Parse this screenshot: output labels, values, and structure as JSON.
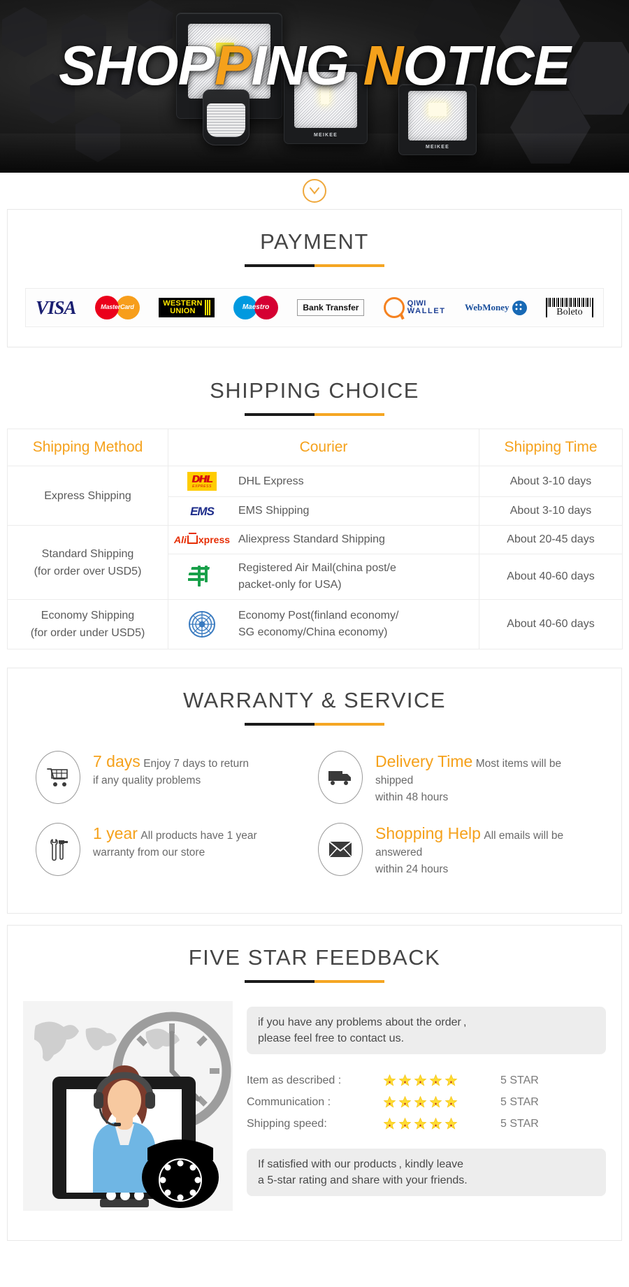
{
  "banner": {
    "title_part1": "SHOP",
    "title_highlight1": "P",
    "title_part2": "ING ",
    "title_highlight2": "N",
    "title_part3": "OTICE",
    "full_title": "SHOPPING NOTICE",
    "brand_tag": "MEIKEE",
    "accent_color": "#F5A11B"
  },
  "scroll_hint": {
    "icon": "chevron-down-icon"
  },
  "payment": {
    "title": "PAYMENT",
    "methods": [
      {
        "name": "VISA",
        "icon": "visa-logo"
      },
      {
        "name": "MasterCard",
        "icon": "mastercard-logo"
      },
      {
        "name": "WESTERN UNION",
        "line1": "WESTERN",
        "line2": "UNION",
        "icon": "western-union-logo"
      },
      {
        "name": "Maestro",
        "icon": "maestro-logo"
      },
      {
        "name": "Bank Transfer",
        "icon": "bank-transfer-logo"
      },
      {
        "name": "QIWI WALLET",
        "line1": "QIWI",
        "line2": "WALLET",
        "icon": "qiwi-wallet-logo"
      },
      {
        "name": "WebMoney",
        "icon": "webmoney-logo"
      },
      {
        "name": "Boleto",
        "icon": "boleto-logo"
      }
    ]
  },
  "shipping": {
    "title": "SHIPPING CHOICE",
    "headers": [
      "Shipping Method",
      "Courier",
      "Shipping Time"
    ],
    "rows": [
      {
        "method": "Express Shipping",
        "method_rowspan": 2,
        "logo": "dhl-logo",
        "courier": "DHL Express",
        "time": "About 3-10 days"
      },
      {
        "method": "",
        "logo": "ems-logo",
        "courier": "EMS Shipping",
        "time": "About 3-10 days"
      },
      {
        "method": "Standard Shipping\n(for order over USD5)",
        "method_line1": "Standard Shipping",
        "method_line2": "(for order over USD5)",
        "method_rowspan": 2,
        "logo": "aliexpress-logo",
        "courier": "Aliexpress Standard Shipping",
        "time": "About 20-45 days"
      },
      {
        "method": "",
        "logo": "china-post-logo",
        "courier": "Registered Air Mail(china post/e packet-only for USA)",
        "time": "About 40-60 days"
      },
      {
        "method": "Economy Shipping\n(for order under USD5)",
        "method_line1": "Economy Shipping",
        "method_line2": "(for order under USD5)",
        "method_rowspan": 1,
        "logo": "united-nations-logo",
        "courier": "Economy Post(finland economy/ SG economy/China economy)",
        "time": "About 40-60 days"
      }
    ],
    "express_method": "Express Shipping",
    "standard_method_l1": "Standard Shipping",
    "standard_method_l2": "(for order over USD5)",
    "economy_method_l1": "Economy Shipping",
    "economy_method_l2": "(for order under USD5)",
    "courier_airmail_l1": "Registered Air Mail(china post/e",
    "courier_airmail_l2": "packet-only for USA)",
    "courier_economy_l1": "Economy Post(finland economy/",
    "courier_economy_l2": "SG economy/China economy)"
  },
  "warranty": {
    "title": "WARRANTY & SERVICE",
    "features": [
      {
        "icon": "shopping-cart-icon",
        "heading": "7 days",
        "line1": "Enjoy 7 days to return",
        "line2": "if any quality problems"
      },
      {
        "icon": "delivery-truck-icon",
        "heading": "Delivery Time",
        "line1": "Most items will be shipped",
        "line2": "within 48 hours"
      },
      {
        "icon": "tools-icon",
        "heading": "1 year",
        "line1": "All products have 1 year",
        "line2": "warranty from our store"
      },
      {
        "icon": "envelope-icon",
        "heading": "Shopping Help",
        "line1": "All emails will be answered",
        "line2": "within 24 hours"
      }
    ]
  },
  "feedback": {
    "title": "FIVE STAR FEEDBACK",
    "illustration": "customer-service-agent-illustration",
    "bubble_top_l1": "if you have any problems about the order ,",
    "bubble_top_l2": "please feel free to contact us.",
    "ratings": [
      {
        "label": "Item as described :",
        "stars": 5,
        "value": "5 STAR"
      },
      {
        "label": "Communication :",
        "stars": 5,
        "value": "5 STAR"
      },
      {
        "label": "Shipping speed:",
        "stars": 5,
        "value": "5 STAR"
      }
    ],
    "bubble_bottom_l1": "If satisfied with our products , kindly leave",
    "bubble_bottom_l2": "a 5-star rating and share with your friends."
  },
  "theme": {
    "orange": "#F5A11B",
    "rule_black": "#1a1a1a",
    "rule_orange": "#F5A623",
    "text_gray": "#5a5a5a",
    "title_gray": "#454545"
  }
}
